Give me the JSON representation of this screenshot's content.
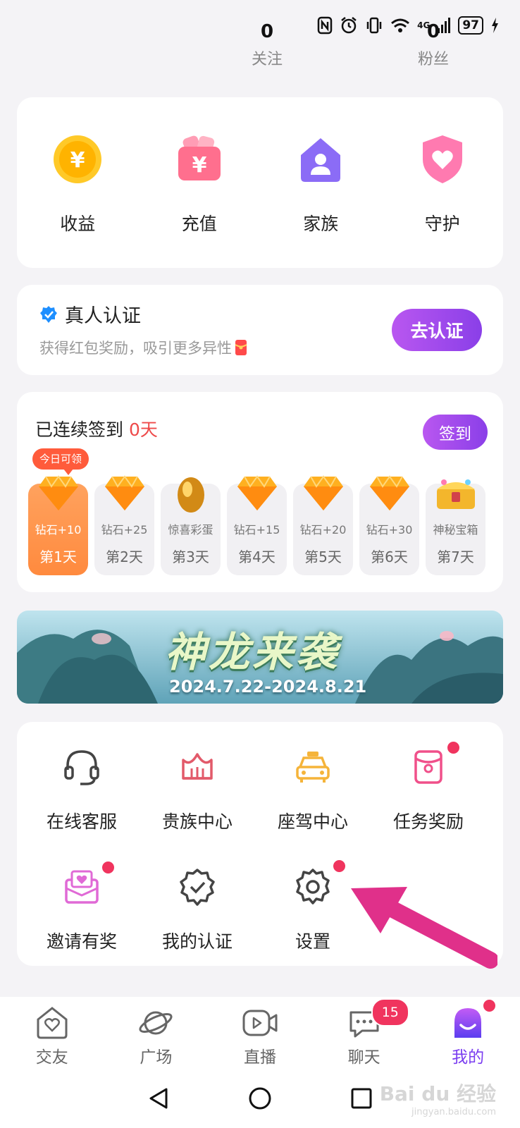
{
  "status": {
    "battery": "97",
    "network": "4G"
  },
  "stats": {
    "following_count": "0",
    "following_label": "关注",
    "fans_count": "0",
    "fans_label": "粉丝"
  },
  "quick": {
    "items": [
      {
        "label": "收益",
        "icon": "yen-coin-icon"
      },
      {
        "label": "充值",
        "icon": "wallet-icon"
      },
      {
        "label": "家族",
        "icon": "family-house-icon"
      },
      {
        "label": "守护",
        "icon": "heart-shield-icon"
      }
    ]
  },
  "verify": {
    "title": "真人认证",
    "subtitle": "获得红包奖励，吸引更多异性",
    "button": "去认证"
  },
  "signin": {
    "prefix": "已连续签到",
    "days": "0天",
    "button": "签到",
    "today_tag": "今日可领",
    "items": [
      {
        "reward": "钻石+10",
        "day": "第1天",
        "icon": "diamond-icon",
        "active": true
      },
      {
        "reward": "钻石+25",
        "day": "第2天",
        "icon": "diamond-icon"
      },
      {
        "reward": "惊喜彩蛋",
        "day": "第3天",
        "icon": "golden-egg-icon"
      },
      {
        "reward": "钻石+15",
        "day": "第4天",
        "icon": "diamond-icon"
      },
      {
        "reward": "钻石+20",
        "day": "第5天",
        "icon": "diamond-icon"
      },
      {
        "reward": "钻石+30",
        "day": "第6天",
        "icon": "diamond-icon"
      },
      {
        "reward": "神秘宝箱",
        "day": "第7天",
        "icon": "treasure-chest-icon"
      }
    ]
  },
  "banner": {
    "title": "神龙来袭",
    "dates": "2024.7.22-2024.8.21"
  },
  "menu": {
    "items": [
      {
        "label": "在线客服",
        "icon": "headset-icon"
      },
      {
        "label": "贵族中心",
        "icon": "crown-icon"
      },
      {
        "label": "座驾中心",
        "icon": "car-icon"
      },
      {
        "label": "任务奖励",
        "icon": "red-packet-icon"
      },
      {
        "label": "邀请有奖",
        "icon": "invite-envelope-icon"
      },
      {
        "label": "我的认证",
        "icon": "verified-badge-icon"
      },
      {
        "label": "设置",
        "icon": "gear-icon"
      }
    ]
  },
  "tabs": [
    {
      "label": "交友",
      "icon": "heart-house-icon"
    },
    {
      "label": "广场",
      "icon": "planet-icon"
    },
    {
      "label": "直播",
      "icon": "video-icon"
    },
    {
      "label": "聊天",
      "icon": "chat-icon",
      "badge": "15"
    },
    {
      "label": "我的",
      "icon": "profile-icon",
      "active": true
    }
  ],
  "watermark": {
    "brand": "Bai du 经验",
    "url": "jingyan.baidu.com"
  },
  "colors": {
    "accent": "#8a3fe8",
    "badge": "#f0345e",
    "signin_active": "#ff8a3e",
    "days_highlight": "#ee4a4a"
  }
}
